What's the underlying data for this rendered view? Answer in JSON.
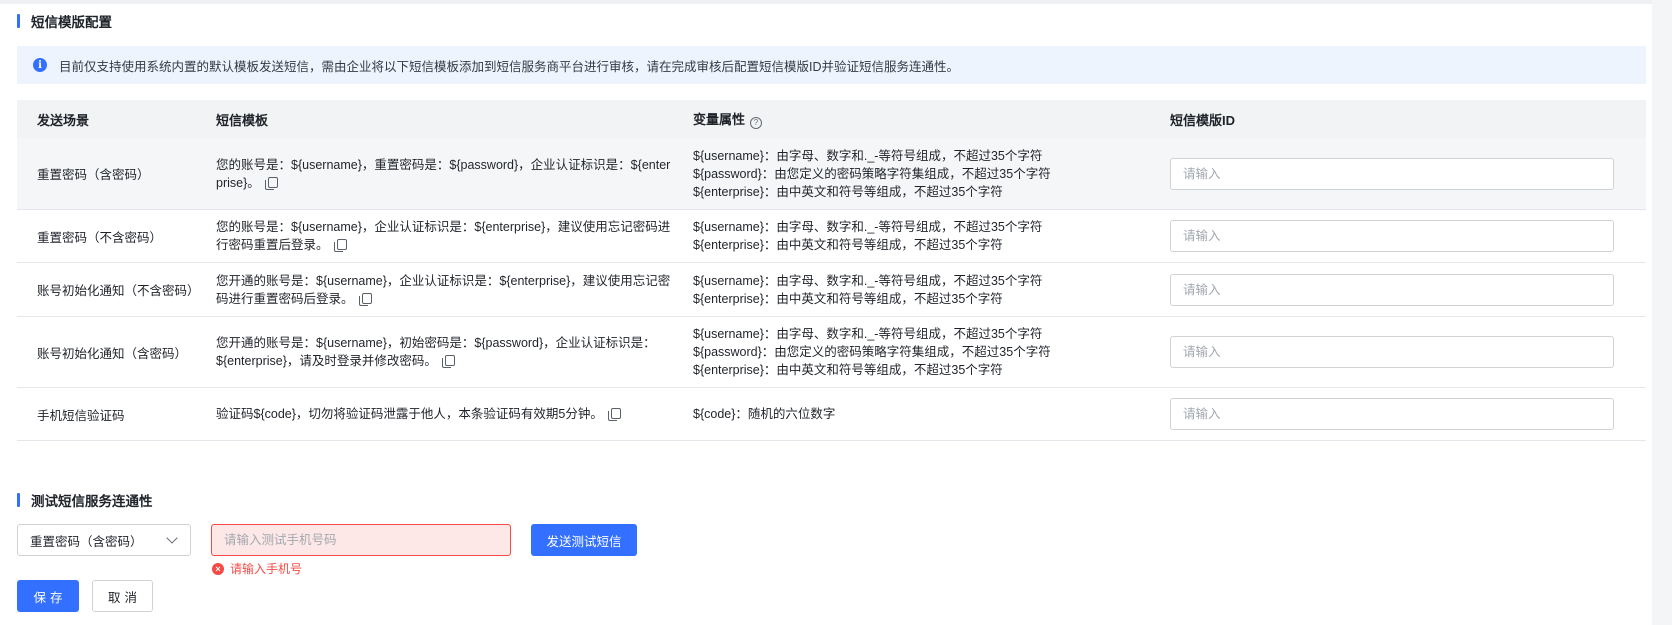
{
  "config_section": {
    "title": "短信模版配置",
    "notice": "目前仅支持使用系统内置的默认模板发送短信，需由企业将以下短信模板添加到短信服务商平台进行审核，请在完成审核后配置短信模版ID并验证短信服务连通性。"
  },
  "table": {
    "headers": [
      "发送场景",
      "短信模板",
      "变量属性",
      "短信模版ID"
    ],
    "id_placeholder": "请输入",
    "rows": [
      {
        "scene": "重置密码（含密码）",
        "template": "您的账号是：${username}，重置密码是：${password}，企业认证标识是：${enterprise}。",
        "vars": [
          "${username}：由字母、数字和._-等符号组成，不超过35个字符",
          "${password}：由您定义的密码策略字符集组成，不超过35个字符",
          "${enterprise}：由中英文和符号等组成，不超过35个字符"
        ]
      },
      {
        "scene": "重置密码（不含密码）",
        "template": "您的账号是：${username}，企业认证标识是：${enterprise}，建议使用忘记密码进行密码重置后登录。",
        "vars": [
          "${username}：由字母、数字和._-等符号组成，不超过35个字符",
          "${enterprise}：由中英文和符号等组成，不超过35个字符"
        ]
      },
      {
        "scene": "账号初始化通知（不含密码）",
        "template": "您开通的账号是：${username}，企业认证标识是：${enterprise}，建议使用忘记密码进行重置密码后登录。",
        "vars": [
          "${username}：由字母、数字和._-等符号组成，不超过35个字符",
          "${enterprise}：由中英文和符号等组成，不超过35个字符"
        ]
      },
      {
        "scene": "账号初始化通知（含密码）",
        "template": "您开通的账号是：${username}，初始密码是：${password}，企业认证标识是：${enterprise}，请及时登录并修改密码。",
        "vars": [
          "${username}：由字母、数字和._-等符号组成，不超过35个字符",
          "${password}：由您定义的密码策略字符集组成，不超过35个字符",
          "${enterprise}：由中英文和符号等组成，不超过35个字符"
        ]
      },
      {
        "scene": "手机短信验证码",
        "template": "验证码${code}，切勿将验证码泄露于他人，本条验证码有效期5分钟。",
        "vars": [
          "${code}：随机的六位数字"
        ]
      }
    ]
  },
  "test_section": {
    "title": "测试短信服务连通性",
    "selected_scene": "重置密码（含密码）",
    "phone_placeholder": "请输入测试手机号码",
    "send_label": "发送测试短信",
    "error": "请输入手机号"
  },
  "actions": {
    "save": "保存",
    "cancel": "取消"
  },
  "colors": {
    "accent": "#3370ff",
    "error": "#f54a45",
    "notice_bg": "#edf4fe"
  }
}
